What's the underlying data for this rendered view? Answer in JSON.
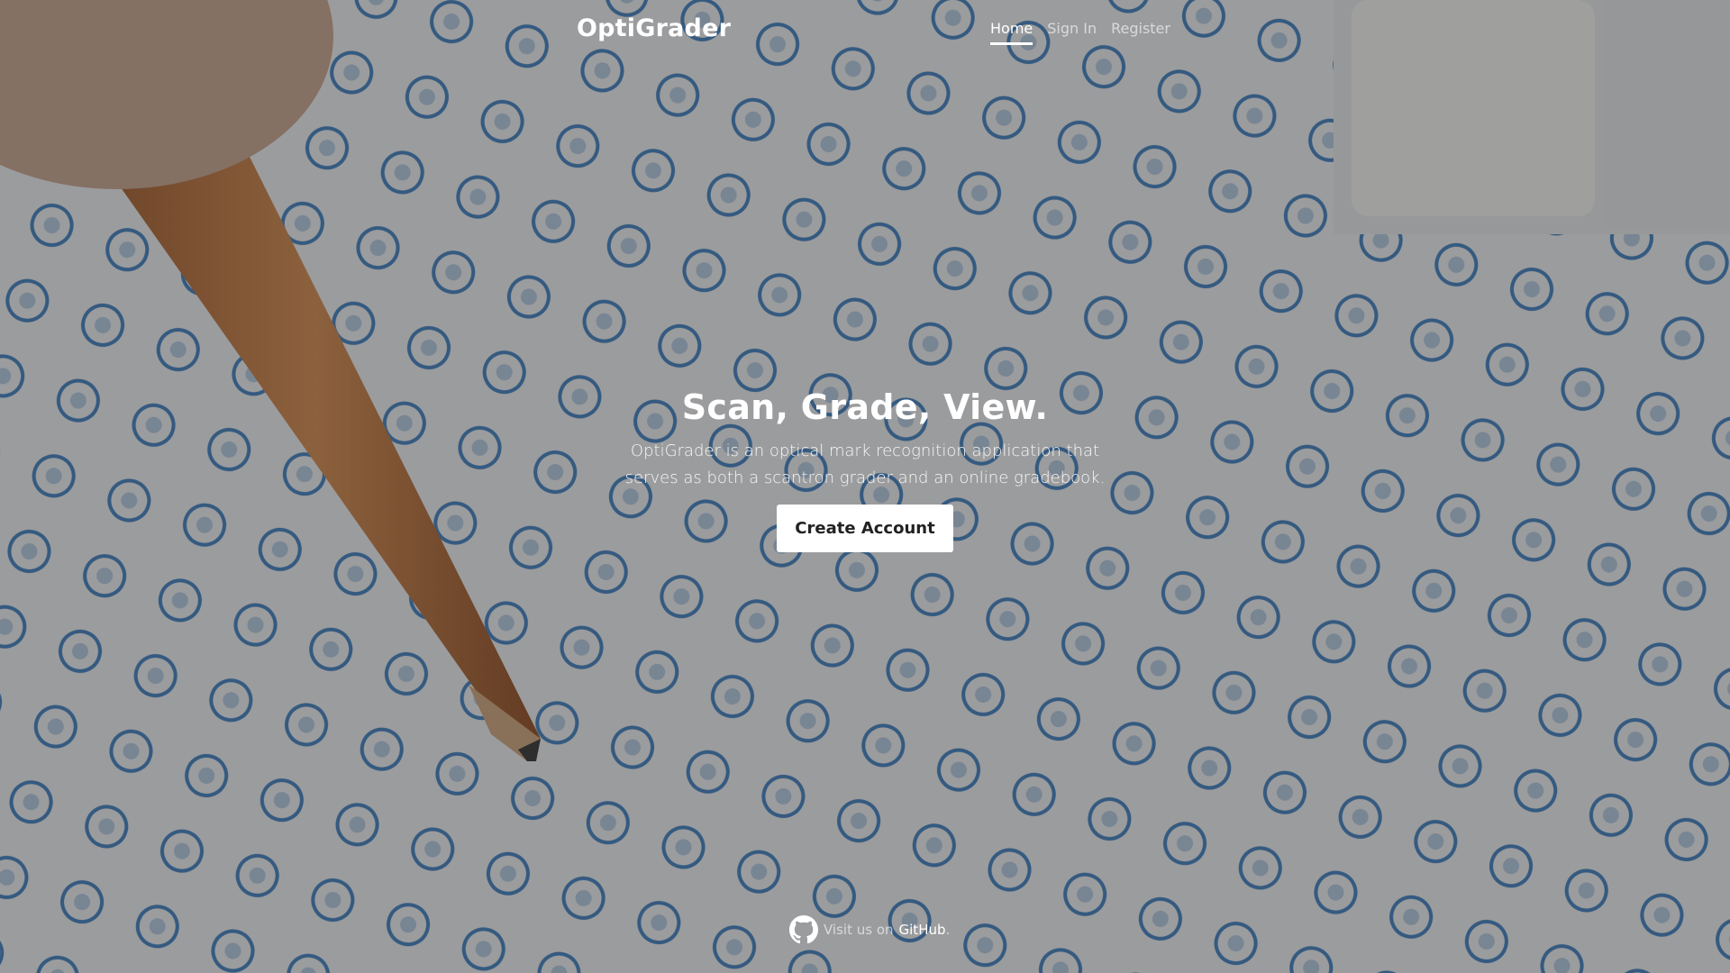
{
  "header": {
    "brand": "OptiGrader",
    "nav": [
      {
        "label": "Home",
        "active": true
      },
      {
        "label": "Sign In",
        "active": false
      },
      {
        "label": "Register",
        "active": false
      }
    ]
  },
  "hero": {
    "title": "Scan, Grade, View.",
    "lead": "OptiGrader is an optical mark recognition application that serves as both a scantron grader and an online gradebook.",
    "button_label": "Create Account"
  },
  "footer": {
    "prefix": "Visit us on",
    "link_label": "GitHub",
    "suffix": ".",
    "icon": "github-icon"
  },
  "background": {
    "image": "scantron-sheet-with-pencil"
  },
  "colors": {
    "overlay": "#282828",
    "text": "#ffffff",
    "bubble_ink": "#2b6fb0"
  }
}
